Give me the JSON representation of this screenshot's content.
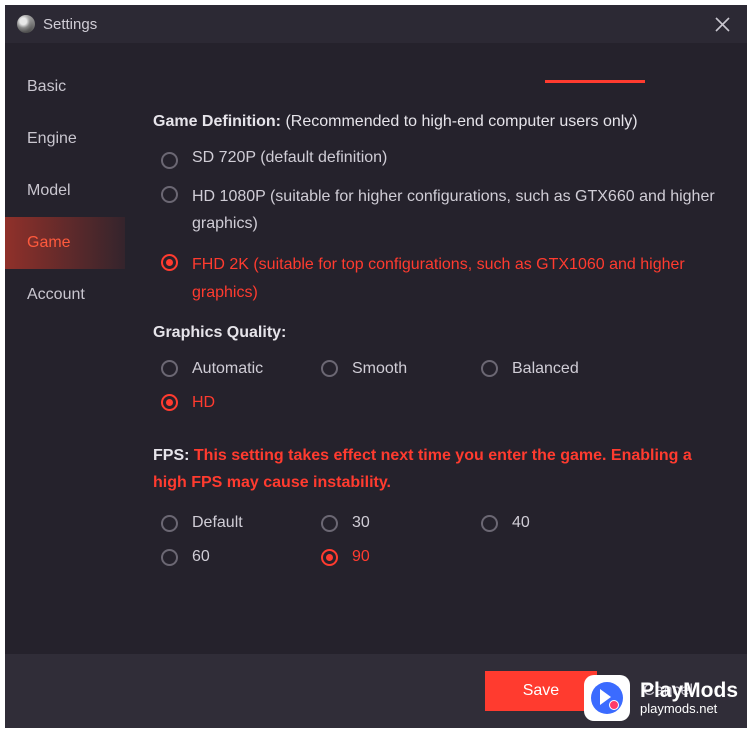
{
  "window": {
    "title": "Settings"
  },
  "sidebar": {
    "items": [
      {
        "label": "Basic"
      },
      {
        "label": "Engine"
      },
      {
        "label": "Model"
      },
      {
        "label": "Game"
      },
      {
        "label": "Account"
      }
    ]
  },
  "sections": {
    "definition": {
      "title": "Game Definition: ",
      "subtitle": "(Recommended to high-end computer users only)",
      "options": [
        {
          "label": "SD 720P (default definition)"
        },
        {
          "label": "HD 1080P (suitable for higher configurations, such as GTX660 and higher graphics)"
        },
        {
          "label": "FHD 2K (suitable for top configurations, such as GTX1060 and higher graphics)"
        }
      ]
    },
    "quality": {
      "title": "Graphics Quality:",
      "options": [
        {
          "label": "Automatic"
        },
        {
          "label": "Smooth"
        },
        {
          "label": "Balanced"
        },
        {
          "label": "HD"
        }
      ]
    },
    "fps": {
      "title": "FPS: ",
      "note": "This setting takes effect next time you enter the game. Enabling a high FPS may cause instability.",
      "options": [
        {
          "label": "Default"
        },
        {
          "label": "30"
        },
        {
          "label": "40"
        },
        {
          "label": "60"
        },
        {
          "label": "90"
        }
      ]
    }
  },
  "footer": {
    "save": "Save",
    "cancel": "Cancel"
  },
  "watermark": {
    "title": "PlayMods",
    "sub": "playmods.net"
  }
}
